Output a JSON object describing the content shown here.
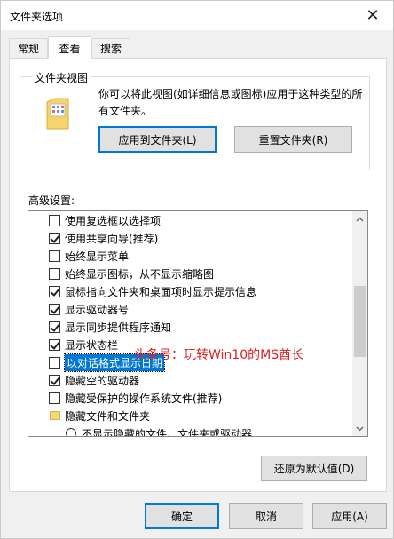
{
  "window": {
    "title": "文件夹选项",
    "close_glyph": "✕"
  },
  "tabs": [
    {
      "label": "常规",
      "active": false
    },
    {
      "label": "查看",
      "active": true
    },
    {
      "label": "搜索",
      "active": false
    }
  ],
  "folder_views": {
    "legend": "文件夹视图",
    "description": "你可以将此视图(如详细信息或图标)应用于这种类型的所有文件夹。",
    "apply_button": "应用到文件夹(L)",
    "reset_button": "重置文件夹(R)"
  },
  "advanced": {
    "label": "高级设置:",
    "items": [
      {
        "type": "checkbox",
        "checked": false,
        "label": "使用复选框以选择项"
      },
      {
        "type": "checkbox",
        "checked": true,
        "label": "使用共享向导(推荐)"
      },
      {
        "type": "checkbox",
        "checked": false,
        "label": "始终显示菜单"
      },
      {
        "type": "checkbox",
        "checked": false,
        "label": "始终显示图标，从不显示缩略图"
      },
      {
        "type": "checkbox",
        "checked": true,
        "label": "鼠标指向文件夹和桌面项时显示提示信息"
      },
      {
        "type": "checkbox",
        "checked": true,
        "label": "显示驱动器号"
      },
      {
        "type": "checkbox",
        "checked": true,
        "label": "显示同步提供程序通知"
      },
      {
        "type": "checkbox",
        "checked": true,
        "label": "显示状态栏"
      },
      {
        "type": "checkbox",
        "checked": false,
        "label": "以对话格式显示日期",
        "selected": true
      },
      {
        "type": "checkbox",
        "checked": true,
        "label": "隐藏空的驱动器"
      },
      {
        "type": "checkbox",
        "checked": false,
        "label": "隐藏受保护的操作系统文件(推荐)"
      },
      {
        "type": "folder",
        "label": "隐藏文件和文件夹"
      },
      {
        "type": "radio",
        "checked": false,
        "label": "不显示隐藏的文件、文件夹或驱动器"
      }
    ]
  },
  "restore_button": "还原为默认值(D)",
  "footer": {
    "ok": "确定",
    "cancel": "取消",
    "apply": "应用(A)"
  },
  "watermark": "头条号：玩转Win10的MS酋长",
  "colors": {
    "selection": "#0078d7",
    "watermark": "#e02020"
  }
}
